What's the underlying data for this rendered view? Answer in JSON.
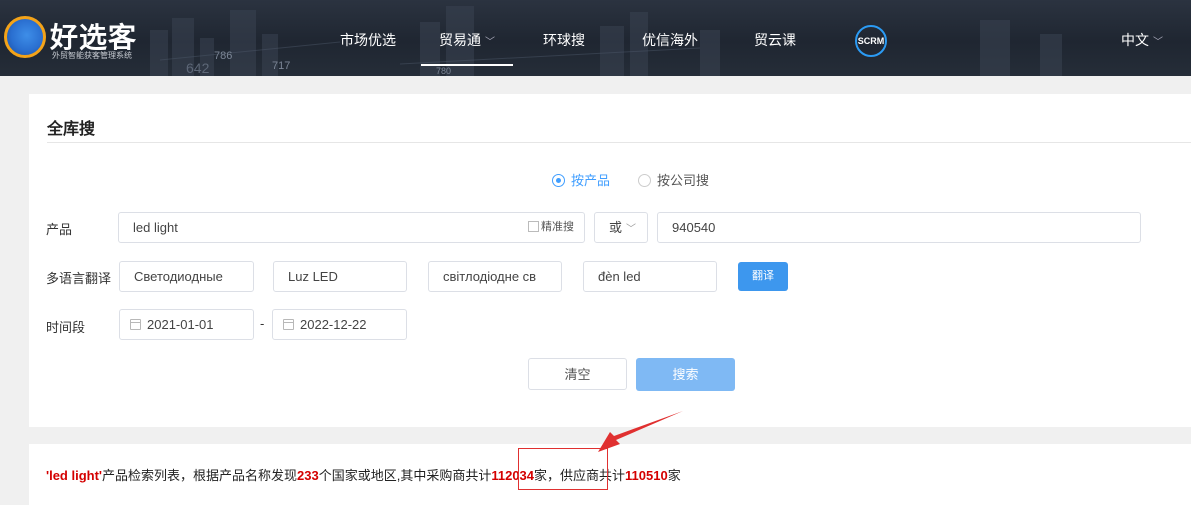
{
  "header": {
    "logo_title": "好选客",
    "logo_subtitle": "外贸智能获客管理系统",
    "nav": [
      {
        "label": "市场优选",
        "has_dropdown": false
      },
      {
        "label": "贸易通",
        "has_dropdown": true,
        "active": true
      },
      {
        "label": "环球搜",
        "has_dropdown": false
      },
      {
        "label": "优信海外",
        "has_dropdown": false
      },
      {
        "label": "贸云课",
        "has_dropdown": false
      }
    ],
    "scrm_label": "SCRM",
    "language": "中文",
    "bg_numbers": [
      "786",
      "642",
      "717",
      "780"
    ]
  },
  "search": {
    "title": "全库搜",
    "modes": [
      {
        "label": "按产品",
        "selected": true
      },
      {
        "label": "按公司搜",
        "selected": false
      }
    ],
    "product_label": "产品",
    "product_value": "led light",
    "exact_label": "精准搜",
    "operator": "或",
    "hs_code": "940540",
    "translate_label": "多语言翻译",
    "translations": [
      "Светодиодные",
      "Luz LED",
      "світлодіодне св",
      "đèn led"
    ],
    "translate_button": "翻译",
    "period_label": "时间段",
    "date_from": "2021-01-01",
    "date_sep": "-",
    "date_to": "2022-12-22",
    "clear_button": "清空",
    "search_button": "搜索"
  },
  "result": {
    "keyword": "'led light'",
    "text1": "产品检索列表，根据产品名称发现",
    "countries": "233",
    "text2": "个国家或地区,其中采购商共计",
    "buyers": "112034",
    "text3": "家，供应商共计",
    "suppliers": "110510",
    "text4": "家"
  },
  "colors": {
    "accent": "#409eff",
    "highlight": "#d40000",
    "header_bg": "#232a35"
  }
}
